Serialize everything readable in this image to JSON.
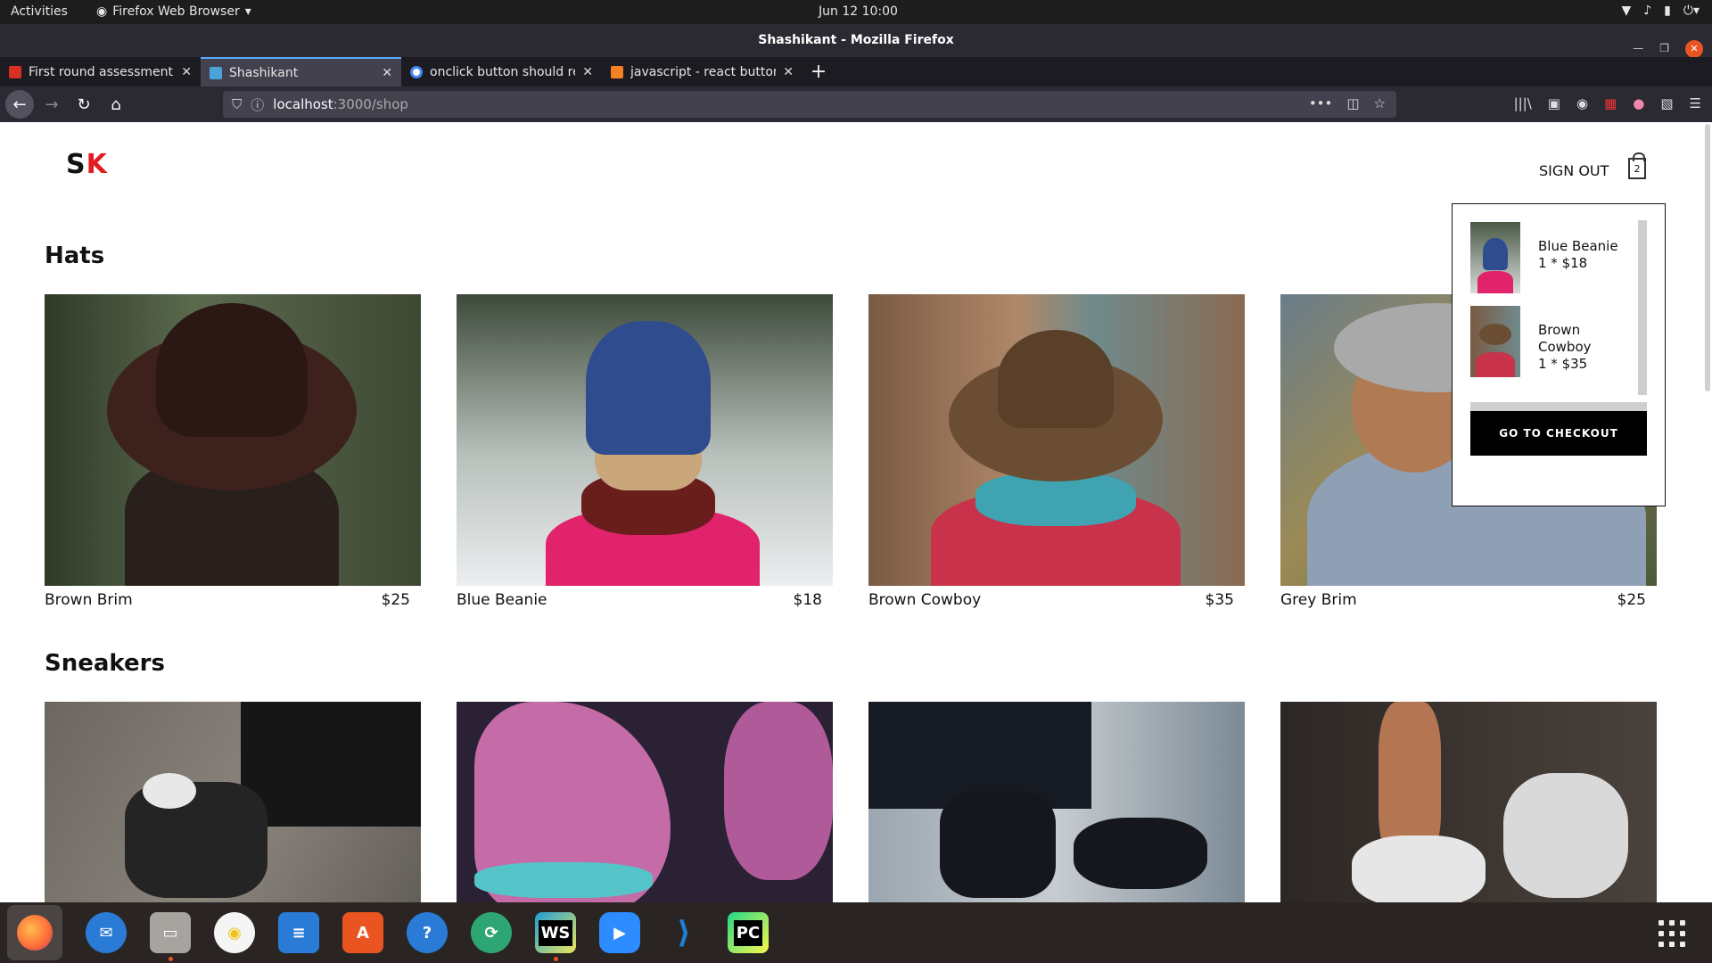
{
  "system": {
    "activities": "Activities",
    "app_menu": "Firefox Web Browser",
    "clock": "Jun 12  10:00"
  },
  "window": {
    "title": "Shashikant - Mozilla Firefox"
  },
  "tabs": [
    {
      "label": "First round assessment",
      "favicon": "gmail-icon",
      "color": "#d93025"
    },
    {
      "label": "Shashikant",
      "favicon": "react-icon",
      "color": "#4aa3d8",
      "active": true
    },
    {
      "label": "onclick button should re",
      "favicon": "google-icon",
      "color": "#ffffff"
    },
    {
      "label": "javascript - react button",
      "favicon": "stackoverflow-icon",
      "color": "#f48024"
    }
  ],
  "address": {
    "host": "localhost",
    "rest": ":3000/shop"
  },
  "site": {
    "logo_s": "S",
    "logo_k": "K",
    "sign_out": "SIGN OUT",
    "cart_count": "2",
    "accent": "#e31b23"
  },
  "cart": {
    "items": [
      {
        "name": "Blue Beanie",
        "qty_price": "1 * $18"
      },
      {
        "name": "Brown Cowboy",
        "qty_price": "1 * $35"
      }
    ],
    "checkout_label": "GO TO CHECKOUT"
  },
  "sections": [
    {
      "title": "Hats",
      "items": [
        {
          "name": "Brown Brim",
          "price": "$25"
        },
        {
          "name": "Blue Beanie",
          "price": "$18"
        },
        {
          "name": "Brown Cowboy",
          "price": "$35"
        },
        {
          "name": "Grey Brim",
          "price": "$25"
        }
      ]
    },
    {
      "title": "Sneakers",
      "items": [
        {
          "name": "",
          "price": ""
        },
        {
          "name": "",
          "price": ""
        },
        {
          "name": "",
          "price": ""
        },
        {
          "name": "",
          "price": ""
        }
      ]
    }
  ],
  "dock": [
    {
      "name": "firefox-icon",
      "color": "#ff7139"
    },
    {
      "name": "thunderbird-icon",
      "color": "#2a7bd6"
    },
    {
      "name": "files-icon",
      "color": "#9b9b9b"
    },
    {
      "name": "rhythmbox-icon",
      "color": "#f0c419"
    },
    {
      "name": "writer-icon",
      "color": "#2a7bd6"
    },
    {
      "name": "software-icon",
      "color": "#e95420"
    },
    {
      "name": "help-icon",
      "color": "#2a7bd6"
    },
    {
      "name": "remmina-icon",
      "color": "#2ea673"
    },
    {
      "name": "webstorm-icon",
      "color": "#1e9ed8",
      "label": "WS"
    },
    {
      "name": "zoom-icon",
      "color": "#2d8cff"
    },
    {
      "name": "vscode-icon",
      "color": "#1f7fd4"
    },
    {
      "name": "pycharm-icon",
      "color": "#21d789",
      "label": "PC"
    }
  ]
}
